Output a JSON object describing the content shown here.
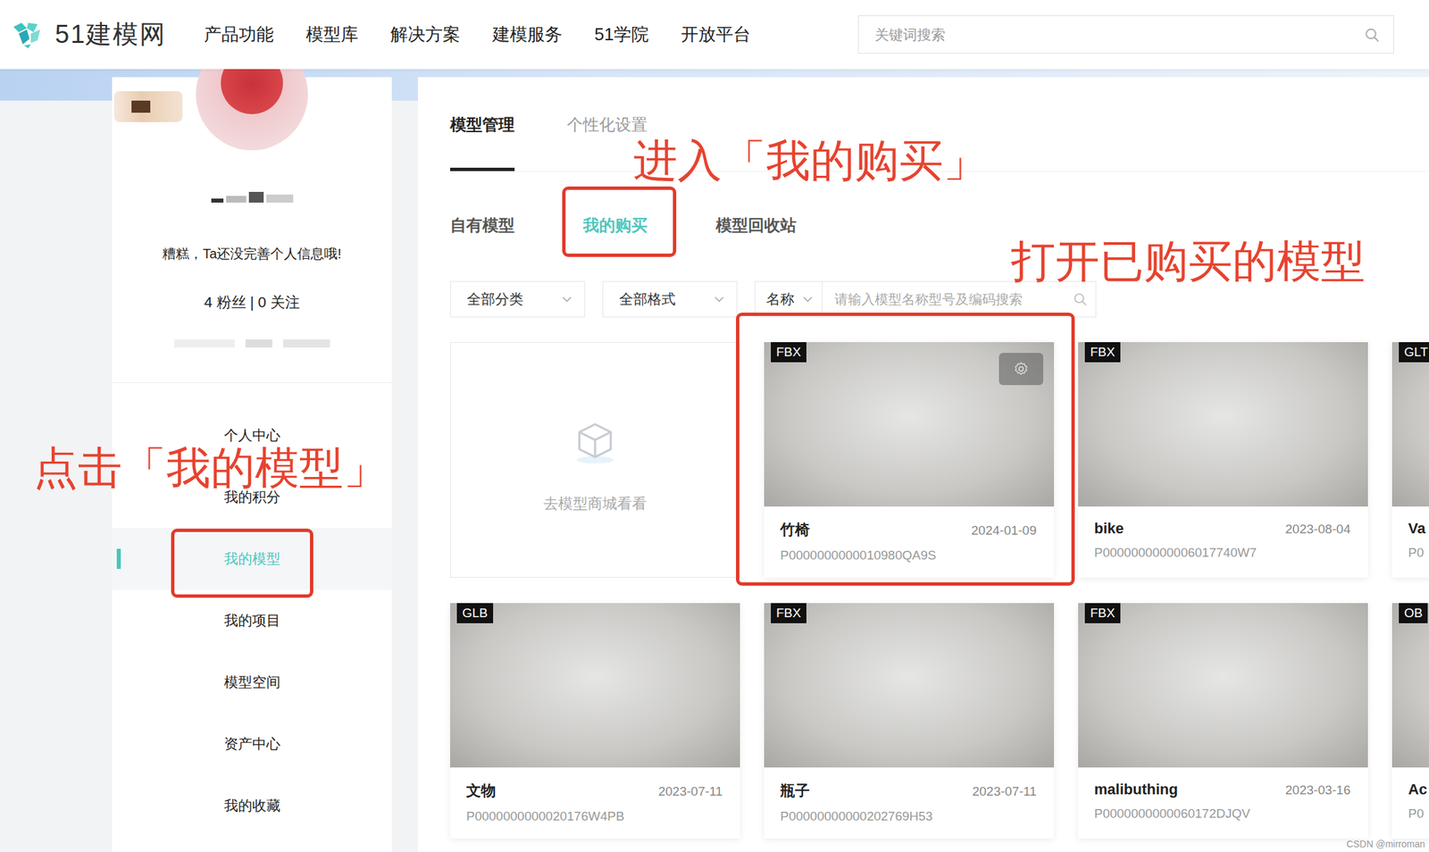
{
  "header": {
    "logo": "51建模网",
    "nav": [
      "产品功能",
      "模型库",
      "解决方案",
      "建模服务",
      "51学院",
      "开放平台"
    ],
    "search": {
      "placeholder": "关键词搜索"
    }
  },
  "profile": {
    "bio": "糟糕，Ta还没完善个人信息哦!",
    "stats": "4 粉丝 | 0 关注"
  },
  "sidebar": {
    "items": [
      {
        "label": "个人中心",
        "selected": false
      },
      {
        "label": "我的积分",
        "selected": false
      },
      {
        "label": "我的模型",
        "selected": true
      },
      {
        "label": "我的项目",
        "selected": false
      },
      {
        "label": "模型空间",
        "selected": false
      },
      {
        "label": "资产中心",
        "selected": false
      },
      {
        "label": "我的收藏",
        "selected": false
      }
    ]
  },
  "tabs": [
    {
      "label": "模型管理",
      "selected": true
    },
    {
      "label": "个性化设置",
      "selected": false
    }
  ],
  "subtabs": [
    {
      "label": "自有模型",
      "selected": false
    },
    {
      "label": "我的购买",
      "selected": true
    },
    {
      "label": "模型回收站",
      "selected": false
    }
  ],
  "filters": {
    "dropdowns": [
      "全部分类",
      "全部格式"
    ],
    "search": {
      "field": "名称",
      "placeholder": "请输入模型名称型号及编码搜索"
    }
  },
  "empty_card": {
    "text": "去模型商城看看"
  },
  "cards": [
    {
      "format": "FBX",
      "name": "竹椅",
      "date": "2024-01-09",
      "code": "P0000000000010980QA9S",
      "settings": true
    },
    {
      "format": "FBX",
      "name": "bike",
      "date": "2023-08-04",
      "code": "P0000000000006017740W7",
      "settings": false
    },
    {
      "format": "GLT",
      "name": "Va",
      "date": "",
      "code": "P0",
      "settings": false
    },
    {
      "format": "GLB",
      "name": "文物",
      "date": "2023-07-11",
      "code": "P0000000000020176W4PB",
      "settings": false
    },
    {
      "format": "FBX",
      "name": "瓶子",
      "date": "2023-07-11",
      "code": "P00000000000202769H53",
      "settings": false
    },
    {
      "format": "FBX",
      "name": "malibuthing",
      "date": "2023-03-16",
      "code": "P0000000000060172DJQV",
      "settings": false
    },
    {
      "format": "OB",
      "name": "Ac",
      "date": "",
      "code": "P0",
      "settings": false
    }
  ],
  "annotations": [
    "进入「我的购买」",
    "打开已购买的模型",
    "点击「我的模型」"
  ],
  "watermark": "CSDN @mirroman"
}
